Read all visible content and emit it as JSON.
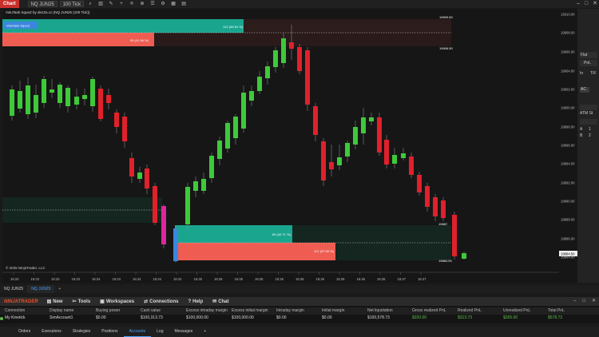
{
  "titlebar": {
    "chart_label": "Chart",
    "instrument": "NQ JUN25",
    "interval": "100 Tick",
    "icons": [
      "search-icon",
      "bars-icon",
      "pencil-icon",
      "plus-icon",
      "crosshair-icon",
      "zoom-icon",
      "list-icon",
      "gear-icon",
      "grid-icon",
      "properties-icon"
    ],
    "window_controls": [
      "minimize-icon",
      "maximize-icon",
      "close-icon"
    ]
  },
  "chart": {
    "indicator_label": "VoluTank SqueZ by dezZa.co (NQ JUN25 (100 Tick))",
    "copyright": "© 2025 NinjaTrader, LLC",
    "y_ticks": [
      "19910.00",
      "19908.00",
      "19906.00",
      "19904.00",
      "19902.00",
      "19900.00",
      "19898.00",
      "19896.00",
      "19894.00",
      "19892.00",
      "19890.00",
      "19888.00",
      "19886.00",
      "19884.00"
    ],
    "x_ticks": [
      "16:23",
      "16:23",
      "16:23",
      "16:23",
      "16:24",
      "16:24",
      "16:24",
      "16:24",
      "16:24",
      "16:25",
      "16:25",
      "16:25",
      "16:25",
      "16:25",
      "16:26",
      "16:26",
      "16:26",
      "16:26",
      "16:26",
      "16:27",
      "16:27"
    ],
    "last_price": "19884.50",
    "zone_top_label": "VoluTank SqueZ",
    "zone_top_bull_text": "122 (55.54 %)",
    "zone_top_bear_text": "99 (41.96 %)",
    "zone_top_price_a": "19909.50",
    "zone_top_price_b": "19906.50",
    "zone_bot_bull_text": "89 (42.71 %)",
    "zone_bot_bear_text": "121 (57.59 %)",
    "zone_bot_price_a": "19887.",
    "zone_bot_price_b": "19884.00",
    "colors": {
      "bull": "#3ec93a",
      "bear": "#e0212b",
      "teal": "#1aa58f",
      "salmon": "#ef5d52",
      "magenta": "#e0259c",
      "blue": "#3b86e0"
    }
  },
  "right_toolbar": {
    "items": [
      "Flat",
      "PnL",
      "In",
      "TIF",
      "AC",
      "ATM St",
      "A",
      "1",
      "B",
      "2"
    ]
  },
  "chart_tabs": [
    "NQ JUN25",
    "NQ JUN25",
    "+"
  ],
  "control_center": {
    "brand": "NINJATRADER",
    "menu": [
      "New",
      "Tools",
      "Workspaces",
      "Connections",
      "Help",
      "Chat"
    ],
    "headers": [
      "Connection",
      "Display name",
      "Buying power",
      "Cash value",
      "Excess intraday margin",
      "Excess initial margin",
      "Intraday margin",
      "Initial margin",
      "Net liquidation",
      "Gross realized PnL",
      "Realized PnL",
      "Unrealized PnL",
      "Total PnL"
    ],
    "row": [
      "My Kinetick",
      "SimAccount1",
      "$0.00",
      "$100,313.73",
      "$100,000.00",
      "$100,000.00",
      "$0.00",
      "$0.00",
      "$100,578.73",
      "$320.00",
      "$313.73",
      "$265.00",
      "$578.73"
    ],
    "bottom_tabs": [
      "Orders",
      "Executions",
      "Strategies",
      "Positions",
      "Accounts",
      "Log",
      "Messages",
      "+"
    ]
  }
}
